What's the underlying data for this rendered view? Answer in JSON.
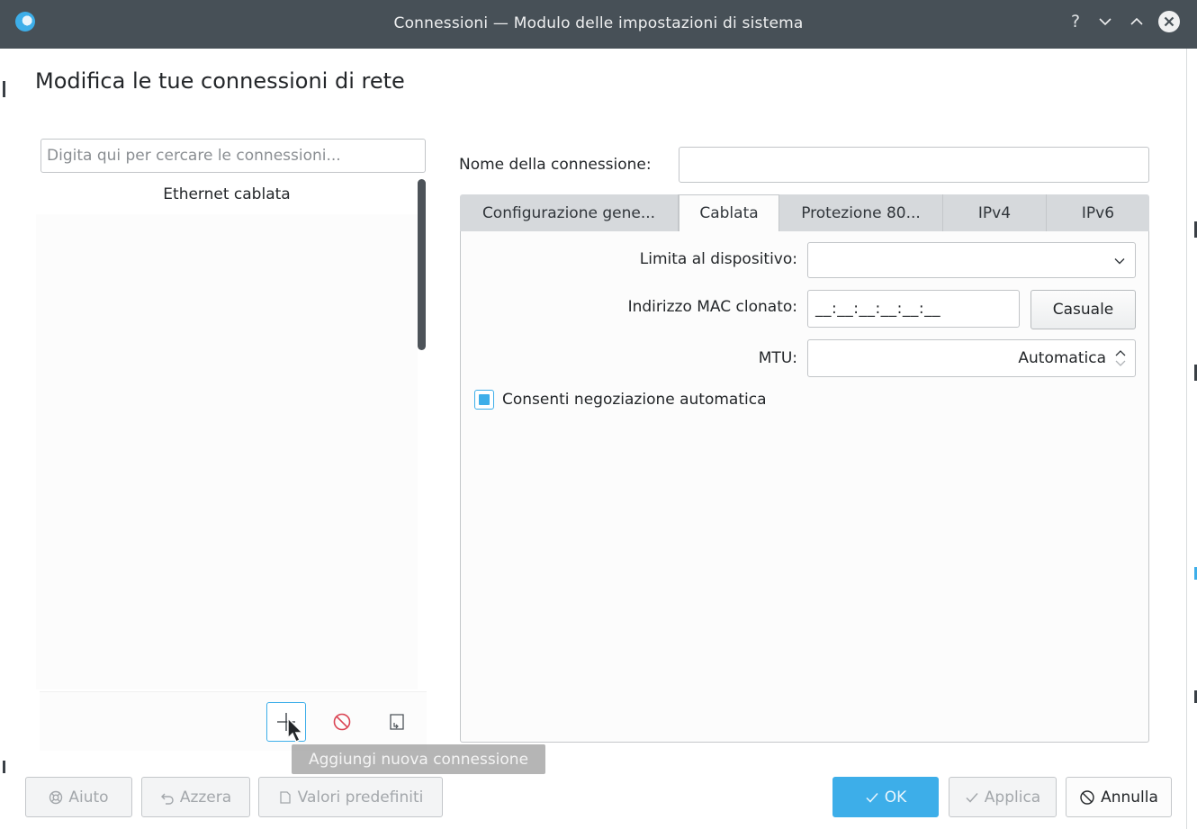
{
  "window": {
    "title": "Connessioni — Modulo delle impostazioni di sistema",
    "help_glyph": "?",
    "accent": "#3daee9",
    "titlebar_color": "#475057"
  },
  "heading": "Modifica le tue connessioni di rete",
  "left_pane": {
    "search_placeholder": "Digita qui per cercare le connessioni...",
    "list_header": "Ethernet cablata",
    "toolbar": {
      "add_icon": "plus-icon",
      "remove_icon": "forbidden-icon",
      "export_icon": "export-icon"
    },
    "tooltip": "Aggiungi nuova connessione"
  },
  "right_pane": {
    "name_label": "Nome della connessione:",
    "name_value": "",
    "tabs": [
      {
        "label": "Configurazione gene...",
        "active": false
      },
      {
        "label": "Cablata",
        "active": true
      },
      {
        "label": "Protezione 80...",
        "active": false
      },
      {
        "label": "IPv4",
        "active": false
      },
      {
        "label": "IPv6",
        "active": false
      }
    ],
    "wired": {
      "device_label": "Limita al dispositivo:",
      "device_value": "",
      "mac_label": "Indirizzo MAC clonato:",
      "mac_value": "__:__:__:__:__:__",
      "random_button": "Casuale",
      "mtu_label": "MTU:",
      "mtu_value": "Automatica",
      "autoneg_label": "Consenti negoziazione automatica",
      "autoneg_checked": true
    }
  },
  "buttons": {
    "help": "Aiuto",
    "reset": "Azzera",
    "defaults": "Valori predefiniti",
    "ok": "OK",
    "apply": "Applica",
    "cancel": "Annulla"
  }
}
